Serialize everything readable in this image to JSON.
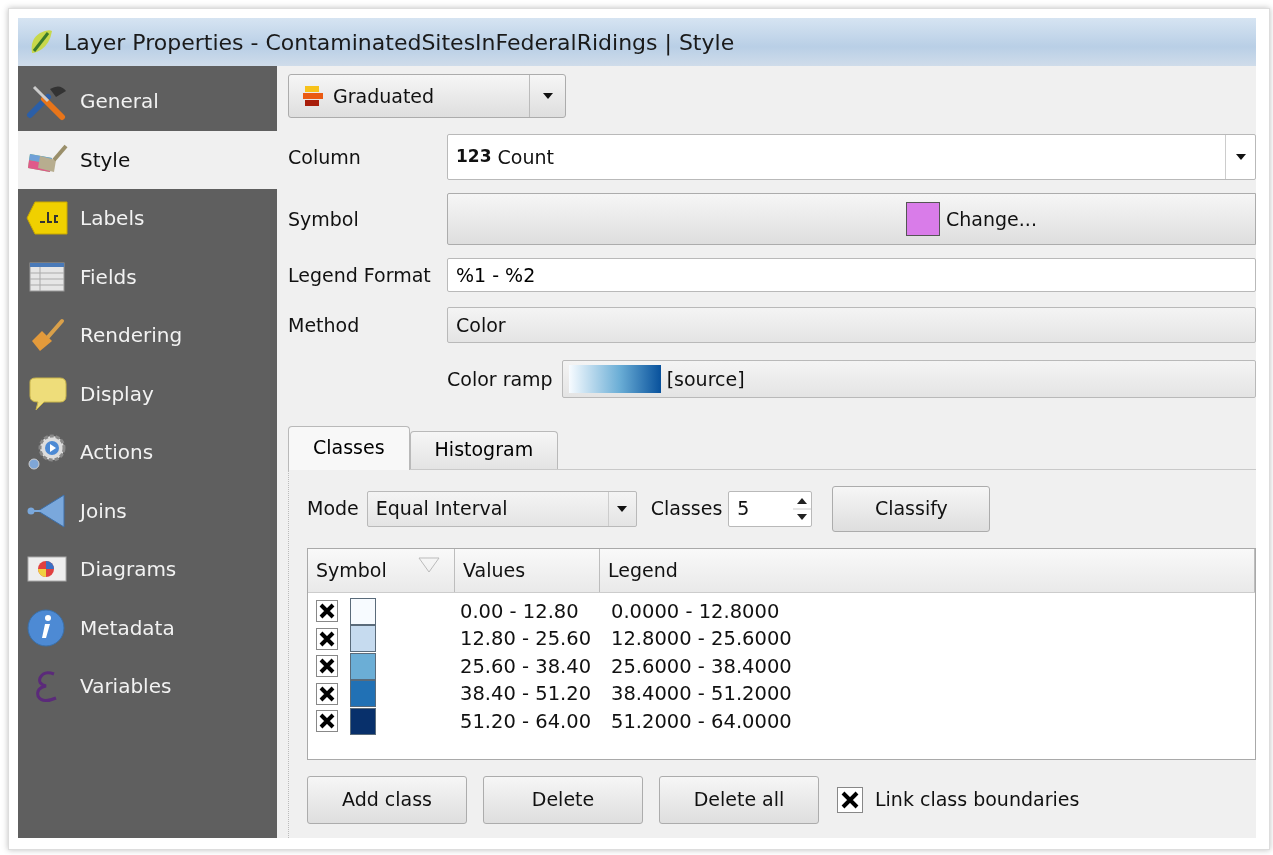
{
  "window": {
    "title": "Layer Properties - ContaminatedSitesInFederalRidings | Style"
  },
  "sidebar": {
    "items": [
      {
        "label": "General",
        "selected": false
      },
      {
        "label": "Style",
        "selected": true
      },
      {
        "label": "Labels",
        "selected": false
      },
      {
        "label": "Fields",
        "selected": false
      },
      {
        "label": "Rendering",
        "selected": false
      },
      {
        "label": "Display",
        "selected": false
      },
      {
        "label": "Actions",
        "selected": false
      },
      {
        "label": "Joins",
        "selected": false
      },
      {
        "label": "Diagrams",
        "selected": false
      },
      {
        "label": "Metadata",
        "selected": false
      },
      {
        "label": "Variables",
        "selected": false
      }
    ]
  },
  "renderer": {
    "value": "Graduated"
  },
  "column": {
    "label": "Column",
    "type_badge": "123",
    "value": "Count"
  },
  "symbol": {
    "label": "Symbol",
    "button": "Change..."
  },
  "legend_format": {
    "label": "Legend Format",
    "value": "%1 - %2"
  },
  "method": {
    "label": "Method",
    "value": "Color"
  },
  "color_ramp": {
    "label": "Color ramp",
    "value": "[source]"
  },
  "tabs": [
    {
      "label": "Classes",
      "selected": true
    },
    {
      "label": "Histogram",
      "selected": false
    }
  ],
  "mode": {
    "label": "Mode",
    "value": "Equal Interval"
  },
  "classes_count": {
    "label": "Classes",
    "value": "5"
  },
  "classify_button": "Classify",
  "table": {
    "columns": [
      "Symbol",
      "Values",
      "Legend"
    ],
    "rows": [
      {
        "checked": true,
        "color": "#f7fbff",
        "values": "0.00 - 12.80",
        "legend": "0.0000 - 12.8000"
      },
      {
        "checked": true,
        "color": "#c6dbef",
        "values": "12.80 - 25.60",
        "legend": "12.8000 - 25.6000"
      },
      {
        "checked": true,
        "color": "#6baed6",
        "values": "25.60 - 38.40",
        "legend": "25.6000 - 38.4000"
      },
      {
        "checked": true,
        "color": "#2171b5",
        "values": "38.40 - 51.20",
        "legend": "38.4000 - 51.2000"
      },
      {
        "checked": true,
        "color": "#08306b",
        "values": "51.20 - 64.00",
        "legend": "51.2000 - 64.0000"
      }
    ]
  },
  "buttons": [
    "Add class",
    "Delete",
    "Delete all"
  ],
  "link_boundaries": {
    "label": "Link class boundaries",
    "checked": true
  }
}
